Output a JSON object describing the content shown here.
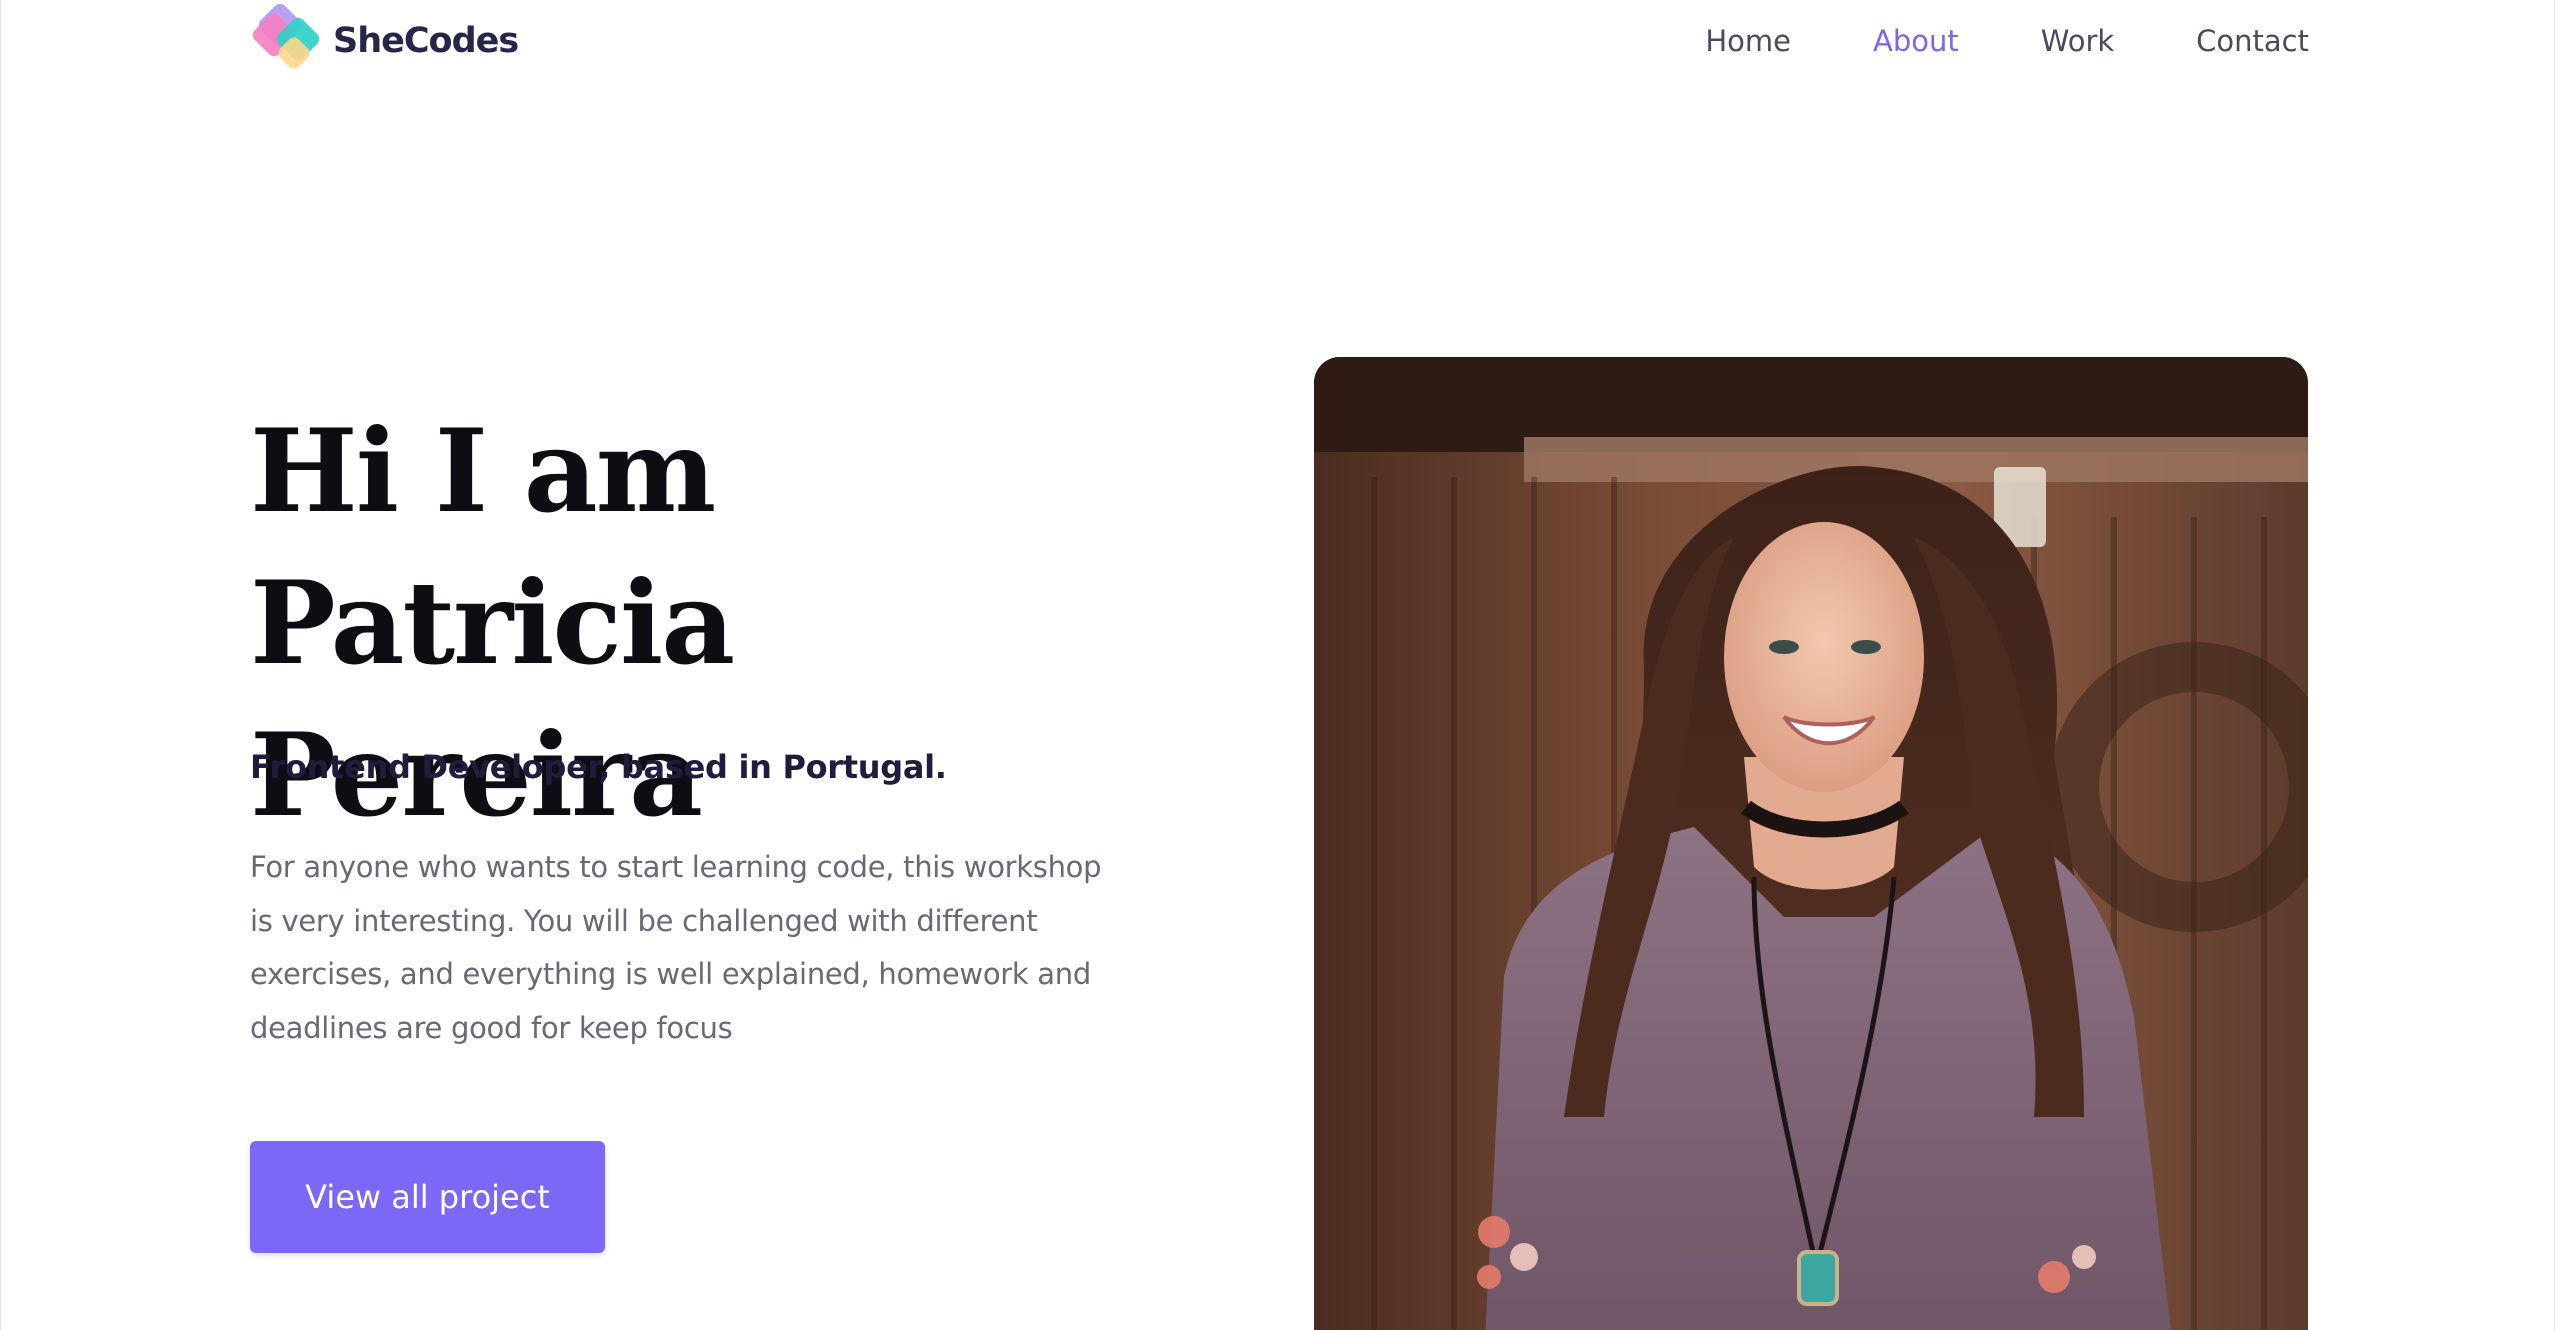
{
  "brand": {
    "name": "SheCodes",
    "logo_colors": [
      "#b79cf4",
      "#f57dc0",
      "#2fd1c6",
      "#fdd68b"
    ]
  },
  "nav": {
    "items": [
      {
        "label": "Home",
        "active": false
      },
      {
        "label": "About",
        "active": true
      },
      {
        "label": "Work",
        "active": false
      },
      {
        "label": "Contact",
        "active": false
      }
    ],
    "active_color": "#7c65f5"
  },
  "hero": {
    "title": "Hi I am Patricia Pereira",
    "subtitle": "Frontend Developer, based in Portugal.",
    "description": "For anyone who wants to start learning code, this workshop is very interesting. You will be challenged  with different exercises, and everything is well explained, homework and deadlines are good for keep focus",
    "cta_label": "View all project",
    "cta_color": "#7b68f6"
  },
  "portrait": {
    "alt": "Smiling woman with long brown hair in a mauve sweater in front of a wooden fence"
  }
}
